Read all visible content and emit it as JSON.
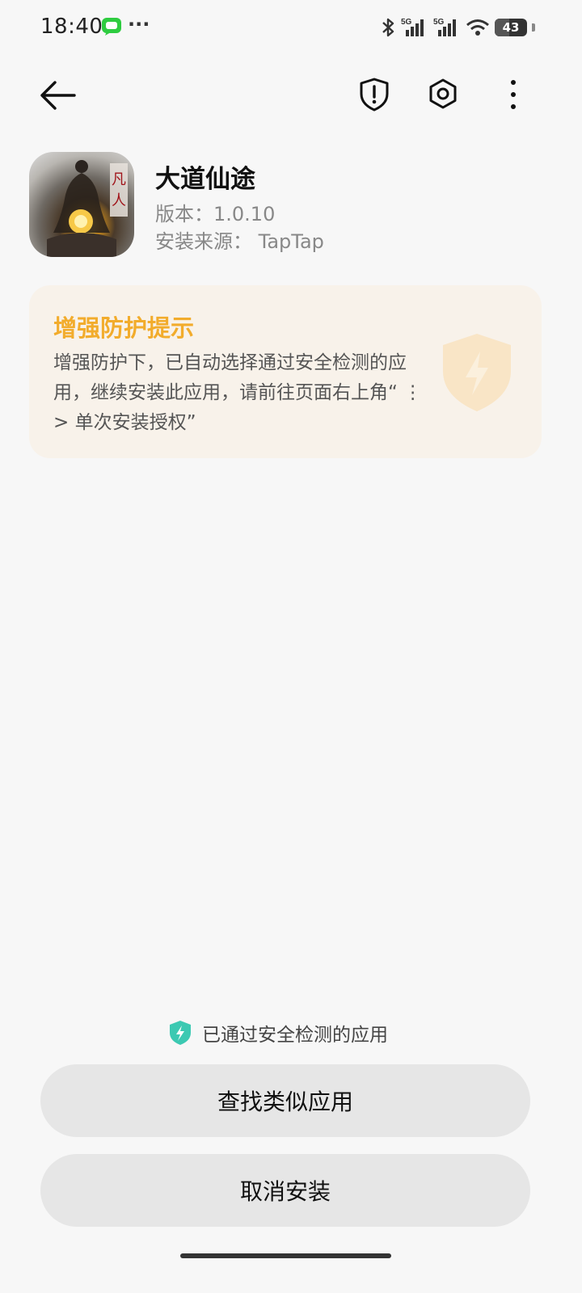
{
  "status_bar": {
    "time": "18:40",
    "battery": "43",
    "signal_1_label": "5G",
    "signal_2_label": "5G",
    "message_icon": "message-icon",
    "overflow": "···"
  },
  "header": {
    "back_icon": "arrow-left-icon",
    "shield_icon": "shield-alert-icon",
    "settings_icon": "settings-icon",
    "menu_icon": "more-vertical-icon"
  },
  "app": {
    "name": "大道仙途",
    "version": "版本：1.0.10",
    "source": "安装来源：  TapTap",
    "icon": "app-icon"
  },
  "protection": {
    "title": "增强防护提示",
    "text": "增强防护下，已自动选择通过安全检测的应用，继续安装此应用，请前往页面右上角“ ⋮ > 单次安装授权”",
    "icon": "shield-bolt-icon"
  },
  "footer": {
    "safe_text": "已通过安全检测的应用",
    "find_similar_label": "查找类似应用",
    "cancel_label": "取消安装"
  },
  "colors": {
    "background": "#f7f7f7",
    "accent_orange": "#f2ac2c",
    "card_bg": "#f8f2ea",
    "button_bg": "#e6e6e6",
    "safe_green": "#3cc9b2"
  }
}
